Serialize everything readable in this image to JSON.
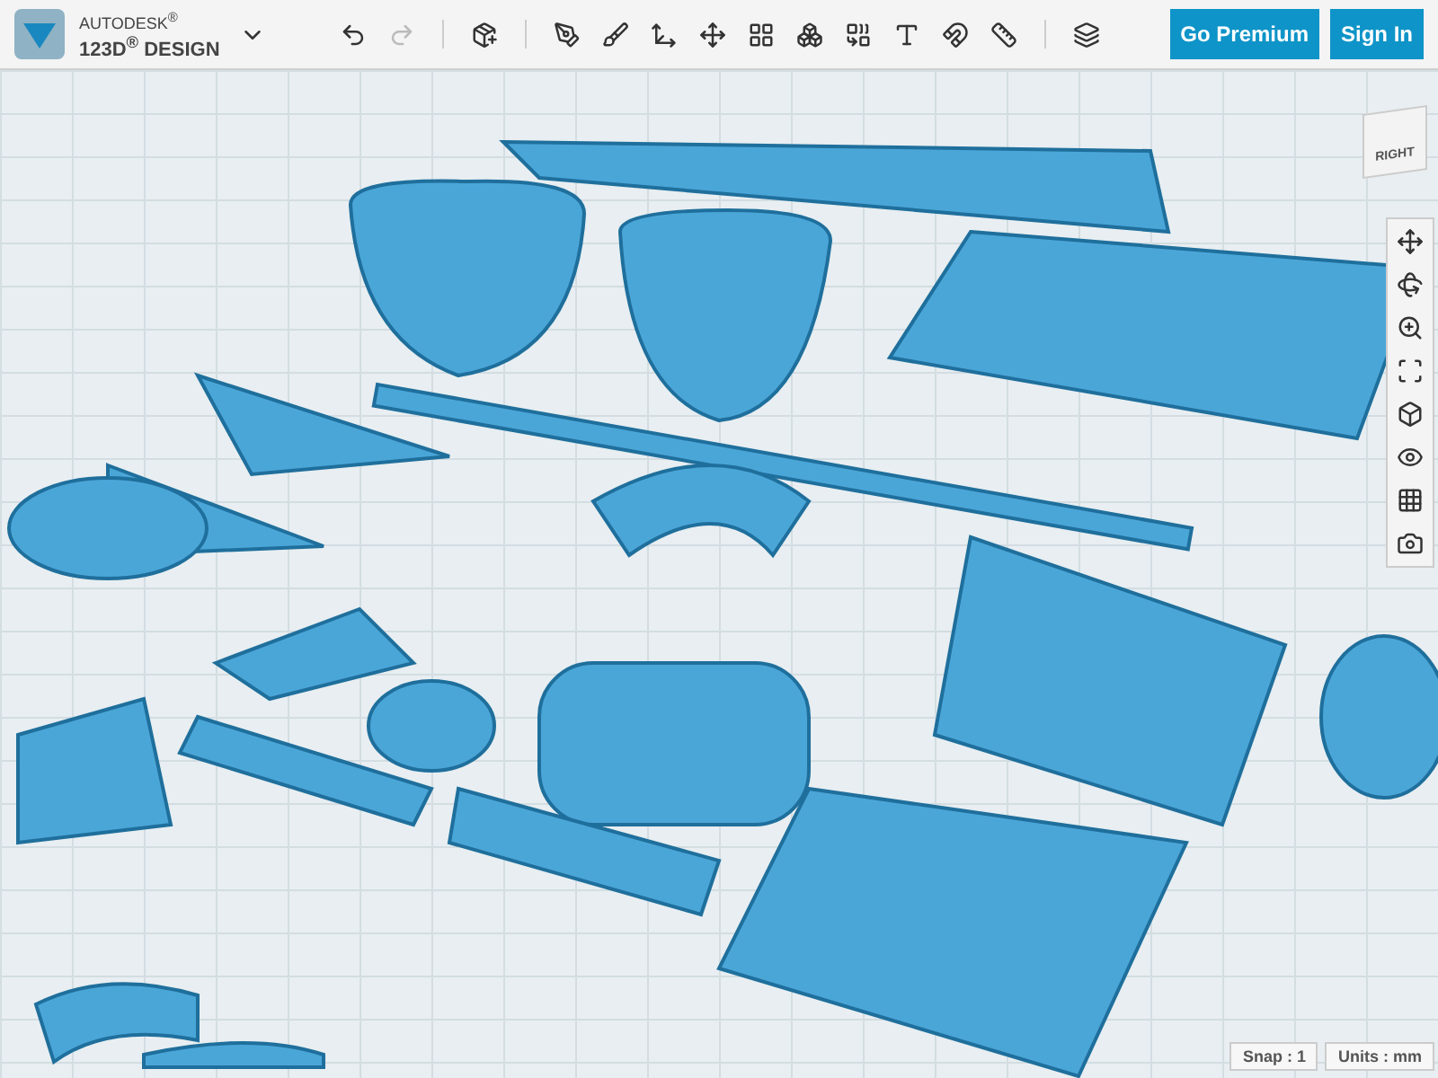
{
  "app": {
    "brand": "AUTODESK$^{®}$",
    "product": "123D$^{®}$ DESIGN"
  },
  "history": [
    {
      "kind": "undo",
      "disabled": false
    },
    {
      "kind": "redo",
      "disabled": true
    }
  ],
  "tools": [
    {
      "kind": "primitives"
    },
    {
      "kind": "sketch"
    },
    {
      "kind": "construct"
    },
    {
      "kind": "modify"
    },
    {
      "kind": "transform"
    },
    {
      "kind": "pattern"
    },
    {
      "kind": "group"
    },
    {
      "kind": "combine"
    },
    {
      "kind": "text"
    },
    {
      "kind": "snap"
    },
    {
      "kind": "measure"
    },
    {
      "kind": "material"
    }
  ],
  "account_buttons": [
    "Go Premium",
    "Sign In"
  ],
  "view_cube": {
    "face": "RIGHT"
  },
  "nav_tools": [
    {
      "kind": "pan"
    },
    {
      "kind": "orbit"
    },
    {
      "kind": "zoom"
    },
    {
      "kind": "fit"
    },
    {
      "kind": "views"
    },
    {
      "kind": "visibility"
    },
    {
      "kind": "grid"
    },
    {
      "kind": "capture"
    }
  ],
  "status_bar": {
    "snap": "Snap : 1",
    "units": "Units : mm"
  }
}
